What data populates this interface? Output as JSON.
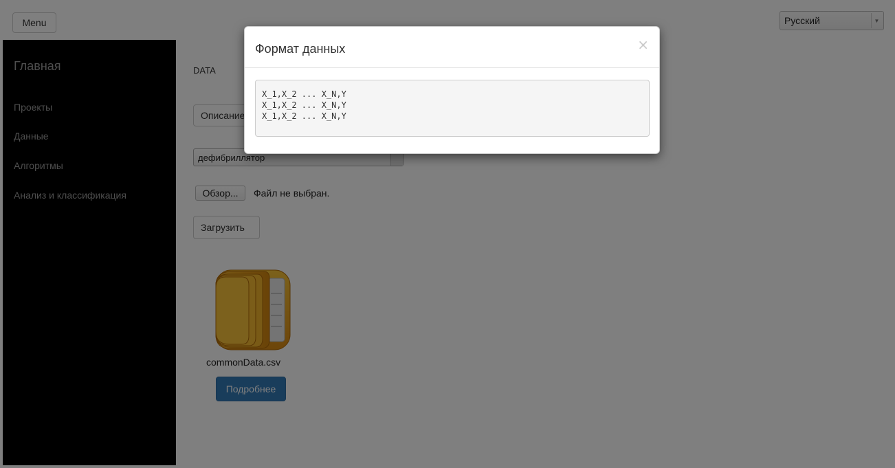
{
  "topbar": {
    "menu_label": "Menu",
    "language": {
      "selected": "Русский"
    }
  },
  "sidebar": {
    "brand": "Главная",
    "items": [
      {
        "label": "Проекты"
      },
      {
        "label": "Данные"
      },
      {
        "label": "Алгоритмы"
      },
      {
        "label": "Анализ и классификация"
      }
    ]
  },
  "main": {
    "title": "DATA",
    "description_button": "Описание",
    "dataset_select": {
      "selected": "дефибриллятор"
    },
    "file_input": {
      "browse_label": "Обзор...",
      "status": "Файл не выбран."
    },
    "upload_button": "Загрузить",
    "file_card": {
      "icon": "folder-archive-icon",
      "name": "commonData.csv",
      "details_button": "Подробнее"
    }
  },
  "modal": {
    "title": "Формат данных",
    "close_glyph": "×",
    "format_lines": [
      "X_1,X_2 ... X_N,Y",
      "X_1,X_2 ... X_N,Y",
      "X_1,X_2 ... X_N,Y"
    ]
  },
  "colors": {
    "sidebar_bg": "#000000",
    "primary_button": "#337ab7",
    "backdrop": "rgba(0,0,0,0.5)"
  }
}
